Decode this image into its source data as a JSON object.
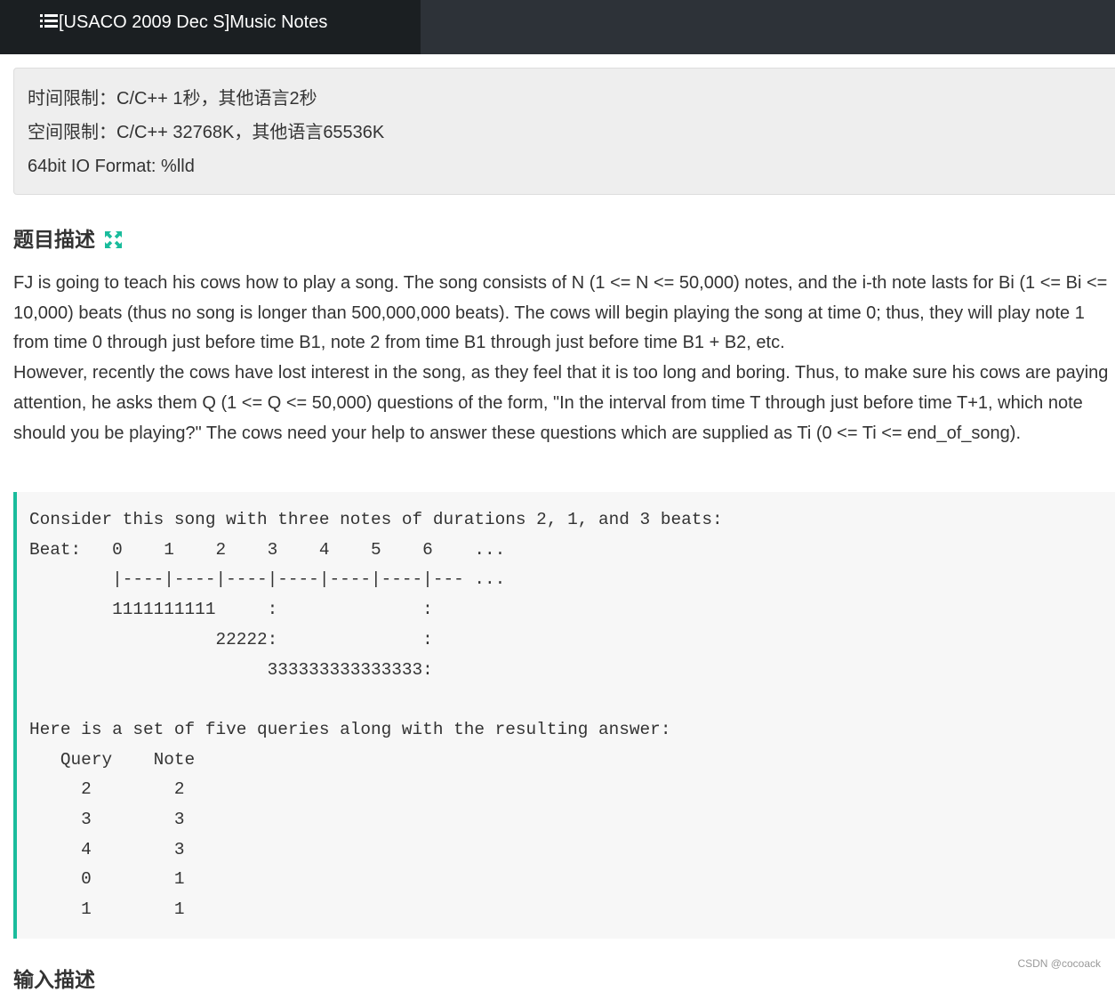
{
  "header": {
    "title": "[USACO 2009 Dec S]Music Notes",
    "icon": "list-icon"
  },
  "limits": {
    "time": "时间限制：C/C++ 1秒，其他语言2秒",
    "space": "空间限制：C/C++ 32768K，其他语言65536K",
    "io_format": "64bit IO Format: %lld"
  },
  "section": {
    "title": "题目描述",
    "icon": "expand-icon",
    "icon_color": "#1abc9c"
  },
  "description": {
    "para1": "FJ is going to teach his cows how to play a song. The song consists of N (1 <= N <= 50,000) notes, and the i-th note lasts for Bi (1 <= Bi <= 10,000) beats (thus no song is longer than 500,000,000 beats). The cows will begin playing the song at time 0; thus, they will play note 1 from time 0 through just before time B1, note 2 from time B1 through just before time B1 + B2, etc.",
    "para2": "However, recently the cows have lost interest in the song, as they feel that it is too long and boring. Thus, to make sure his cows are paying attention, he asks them Q (1 <= Q <= 50,000) questions of the form, \"In the interval from time T through just before time T+1, which note should you be playing?\" The cows need your help to answer these questions which are supplied as Ti (0 <= Ti <= end_of_song)."
  },
  "example": {
    "text": "Consider this song with three notes of durations 2, 1, and 3 beats:\nBeat:   0    1    2    3    4    5    6    ...\n        |----|----|----|----|----|----|--- ...\n        1111111111     :              :\n                  22222:              :\n                       333333333333333:\n\nHere is a set of five queries along with the resulting answer:\n   Query    Note\n     2        2\n     3        3\n     4        3\n     0        1\n     1        1",
    "accent_color": "#1abc9c"
  },
  "next_section": {
    "title": "输入描述"
  },
  "watermark": "CSDN @cocoack"
}
